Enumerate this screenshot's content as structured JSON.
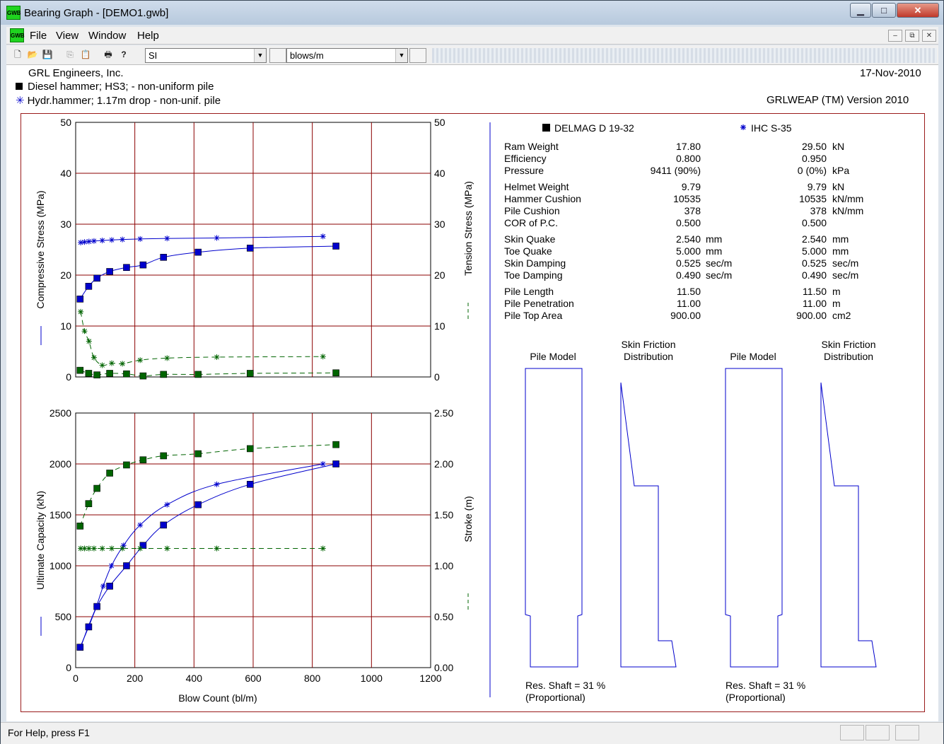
{
  "window": {
    "title": "Bearing Graph - [DEMO1.gwb]",
    "app_icon_text": "GWB",
    "buttons": {
      "minimize": "▁",
      "maximize": "□",
      "close": "✕"
    }
  },
  "menu": {
    "items": [
      "File",
      "View",
      "Window",
      "Help"
    ],
    "mdi_buttons": [
      "‒",
      "⧉",
      "✕"
    ]
  },
  "toolbar": {
    "icons": [
      "new-icon",
      "open-icon",
      "save-icon",
      "copy-icon",
      "paste-icon",
      "print-icon",
      "help-icon"
    ],
    "units_select": "SI",
    "blows_select": "blows/m"
  },
  "header": {
    "company": "GRL Engineers, Inc.",
    "date": "17-Nov-2010",
    "legend1": "Diesel hammer; HS3; - non-uniform pile",
    "legend2": "Hydr.hammer; 1.17m drop - non-unif. pile",
    "version": "GRLWEAP (TM) Version 2010"
  },
  "chart_data": [
    {
      "type": "line",
      "id": "stress",
      "ylabel": "Compressive Stress (MPa)",
      "y2label": "Tension Stress (MPa)",
      "xlim": [
        0,
        1200
      ],
      "ylim": [
        0,
        50
      ],
      "y2lim": [
        0,
        50
      ],
      "yticks": [
        0,
        10,
        20,
        30,
        40,
        50
      ],
      "y2ticks": [
        0,
        10,
        20,
        30,
        40,
        50
      ],
      "grid": true,
      "colors": {
        "compressive": "#0000cc",
        "tension": "#006400",
        "grid": "#8b0000"
      },
      "series": [
        {
          "name": "",
          "marker": "square",
          "style": "solid",
          "color": "#0000cc",
          "x": [
            15,
            44,
            72,
            115,
            172,
            228,
            297,
            414,
            590,
            880
          ],
          "y": [
            15.3,
            17.8,
            19.4,
            20.7,
            21.5,
            22.0,
            23.5,
            24.5,
            25.3,
            25.7
          ]
        },
        {
          "name": "",
          "marker": "star",
          "style": "solid",
          "color": "#0000cc",
          "x": [
            17,
            30,
            45,
            62,
            90,
            122,
            158,
            218,
            309,
            477,
            836
          ],
          "y": [
            26.4,
            26.5,
            26.6,
            26.7,
            26.8,
            26.9,
            27.0,
            27.1,
            27.2,
            27.3,
            27.6
          ]
        },
        {
          "name": "",
          "marker": "square",
          "style": "dashed",
          "color": "#006400",
          "x": [
            15,
            44,
            72,
            115,
            172,
            228,
            297,
            414,
            590,
            880
          ],
          "y": [
            1.3,
            0.7,
            0.4,
            0.7,
            0.6,
            0.2,
            0.5,
            0.5,
            0.7,
            0.8
          ]
        },
        {
          "name": "",
          "marker": "star",
          "style": "dashed",
          "color": "#006400",
          "x": [
            17,
            30,
            45,
            62,
            90,
            122,
            158,
            218,
            309,
            477,
            836
          ],
          "y": [
            12.8,
            9.0,
            7.0,
            3.8,
            2.3,
            2.7,
            2.6,
            3.3,
            3.7,
            3.9,
            4.0
          ]
        }
      ]
    },
    {
      "type": "line",
      "id": "capacity",
      "xlabel": "Blow Count (bl/m)",
      "ylabel": "Ultimate Capacity (kN)",
      "y2label": "Stroke (m)",
      "xlim": [
        0,
        1200
      ],
      "ylim": [
        0,
        2500
      ],
      "y2lim": [
        0,
        2.5
      ],
      "xticks": [
        0,
        200,
        400,
        600,
        800,
        1000,
        1200
      ],
      "yticks": [
        0,
        500,
        1000,
        1500,
        2000,
        2500
      ],
      "y2ticks": [
        "0.00",
        "0.50",
        "1.00",
        "1.50",
        "2.00",
        "2.50"
      ],
      "grid": true,
      "series": [
        {
          "name": "",
          "marker": "square",
          "style": "solid",
          "color": "#0000cc",
          "x": [
            15,
            44,
            72,
            115,
            172,
            228,
            297,
            414,
            590,
            880
          ],
          "y": [
            200,
            400,
            600,
            800,
            1000,
            1200,
            1400,
            1600,
            1800,
            2000
          ]
        },
        {
          "name": "",
          "marker": "star",
          "style": "solid",
          "color": "#0000cc",
          "x": [
            17,
            42,
            70,
            93,
            121,
            162,
            218,
            309,
            477,
            836
          ],
          "y": [
            200,
            400,
            600,
            800,
            1000,
            1200,
            1400,
            1600,
            1800,
            2000
          ]
        },
        {
          "name": "",
          "marker": "square",
          "style": "dashed",
          "color": "#006400",
          "axis": "y2",
          "x": [
            15,
            44,
            72,
            115,
            172,
            228,
            297,
            414,
            590,
            880
          ],
          "y": [
            1.39,
            1.61,
            1.76,
            1.91,
            1.99,
            2.04,
            2.08,
            2.1,
            2.15,
            2.19
          ]
        },
        {
          "name": "",
          "marker": "star",
          "style": "dashed",
          "color": "#006400",
          "axis": "y2",
          "x": [
            17,
            30,
            45,
            62,
            90,
            122,
            158,
            218,
            309,
            477,
            836
          ],
          "y": [
            1.17,
            1.17,
            1.17,
            1.17,
            1.17,
            1.17,
            1.17,
            1.17,
            1.17,
            1.17,
            1.17
          ]
        }
      ]
    }
  ],
  "params": {
    "hammer1": "DELMAG    D 19-32",
    "hammer2": "IHC        S-35",
    "rows": [
      {
        "label": "Ram Weight",
        "v1": "17.80",
        "u1": "",
        "v2": "29.50",
        "u2": "kN"
      },
      {
        "label": "Efficiency",
        "v1": "0.800",
        "u1": "",
        "v2": "0.950",
        "u2": ""
      },
      {
        "label": "Pressure",
        "v1": "9411 (90%)",
        "u1": "",
        "v2": "0 (0%)",
        "u2": "kPa"
      },
      {
        "label": "Helmet Weight",
        "v1": "9.79",
        "u1": "",
        "v2": "9.79",
        "u2": "kN"
      },
      {
        "label": "Hammer Cushion",
        "v1": "10535",
        "u1": "",
        "v2": "10535",
        "u2": "kN/mm"
      },
      {
        "label": "Pile Cushion",
        "v1": "378",
        "u1": "",
        "v2": "378",
        "u2": "kN/mm"
      },
      {
        "label": "COR of P.C.",
        "v1": "0.500",
        "u1": "",
        "v2": "0.500",
        "u2": ""
      },
      {
        "label": "Skin Quake",
        "v1": "2.540",
        "u1": "mm",
        "v2": "2.540",
        "u2": "mm"
      },
      {
        "label": "Toe Quake",
        "v1": "5.000",
        "u1": "mm",
        "v2": "5.000",
        "u2": "mm"
      },
      {
        "label": "Skin Damping",
        "v1": "0.525",
        "u1": "sec/m",
        "v2": "0.525",
        "u2": "sec/m"
      },
      {
        "label": "Toe Damping",
        "v1": "0.490",
        "u1": "sec/m",
        "v2": "0.490",
        "u2": "sec/m"
      },
      {
        "label": "Pile Length",
        "v1": "11.50",
        "u1": "",
        "v2": "11.50",
        "u2": "m"
      },
      {
        "label": "Pile Penetration",
        "v1": "11.00",
        "u1": "",
        "v2": "11.00",
        "u2": "m"
      },
      {
        "label": "Pile Top Area",
        "v1": "900.00",
        "u1": "",
        "v2": "900.00",
        "u2": "cm2"
      }
    ]
  },
  "pile": {
    "pile_model": "Pile Model",
    "skin_friction_1": "Skin Friction",
    "skin_friction_2": "Distribution",
    "res_shaft": "Res. Shaft = 31 %",
    "proportional": "(Proportional)"
  },
  "status": {
    "text": "For Help, press F1"
  }
}
